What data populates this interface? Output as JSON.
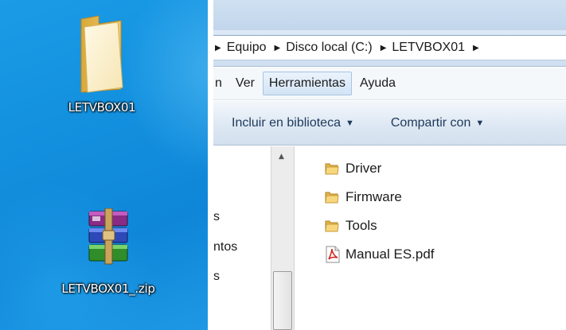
{
  "desktop": {
    "icons": [
      {
        "label": "LETVBOX01",
        "icon": "folder-icon"
      },
      {
        "label": "LETVBOX01_.zip",
        "icon": "winrar-archive-icon"
      }
    ]
  },
  "explorer": {
    "breadcrumb": [
      "Equipo",
      "Disco local (C:)",
      "LETVBOX01"
    ],
    "menu": [
      "n",
      "Ver",
      "Herramientas",
      "Ayuda"
    ],
    "active_menu": "Herramientas",
    "toolbar": {
      "library_label": "Incluir en biblioteca",
      "share_label": "Compartir con"
    },
    "nav_items": [
      "s",
      "ntos",
      "s"
    ],
    "files": [
      {
        "name": "Driver",
        "icon": "folder-icon"
      },
      {
        "name": "Firmware",
        "icon": "folder-icon"
      },
      {
        "name": "Tools",
        "icon": "folder-icon"
      },
      {
        "name": "Manual ES.pdf",
        "icon": "pdf-icon"
      }
    ]
  },
  "colors": {
    "desktop_blue": "#1391df",
    "menu_highlight": "#d3e4f6",
    "toolbar_text": "#1e395b"
  }
}
